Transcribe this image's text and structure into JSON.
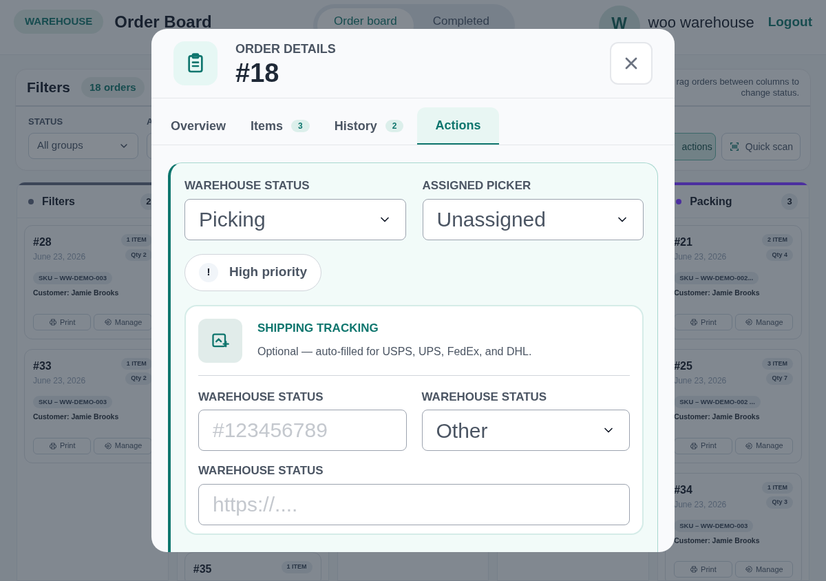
{
  "header": {
    "badge": "WAREHOUSE",
    "title": "Order Board",
    "nav_tabs": [
      {
        "label": "Order board",
        "selected": true
      },
      {
        "label": "Completed",
        "selected": false
      }
    ],
    "avatar": "W",
    "user": "woo warehouse",
    "logout": "Logout"
  },
  "filters": {
    "title": "Filters",
    "count": "18 orders",
    "hint": "rag orders between columns to change status.",
    "fields": [
      {
        "label": "STATUS",
        "value": "All groups"
      },
      {
        "label": "A"
      }
    ],
    "buttons": [
      {
        "kind": "actions",
        "label": "actions",
        "selected": true
      },
      {
        "kind": "scan",
        "label": "Quick scan",
        "selected": false
      }
    ]
  },
  "columns": [
    {
      "title": "Filters",
      "color": "#3b4557",
      "count": "2",
      "cards": [
        {
          "number": "#28",
          "items": "1 ITEM",
          "qty": "Qty 2",
          "date": "June 23, 2026",
          "sku": "SKU – WW-DEMO-003",
          "customer": "Customer: Jamie Brooks",
          "actions": [
            "Print",
            "Manage"
          ]
        },
        {
          "number": "#33",
          "items": "1 ITEM",
          "qty": "Qty 2",
          "date": "June 23, 2026",
          "sku": "SKU – WW-DEMO-003",
          "customer": "Customer: Jamie Brooks",
          "actions": [
            "Print",
            "Manage"
          ]
        }
      ]
    },
    {
      "cards": [
        {
          "number": "#35",
          "items": "1 ITEM"
        }
      ]
    },
    {},
    {},
    {
      "title": "Packing",
      "color": "#4c2f9f",
      "count": "3",
      "cards": [
        {
          "number": "#21",
          "items": "2 ITEM",
          "qty": "Qty 4",
          "date": "June 23, 2026",
          "sku": "SKU – WW-DEMO-002...",
          "customer": "Customer: Jamie Brooks",
          "actions": [
            "Print",
            "Manage"
          ]
        },
        {
          "number": "#25",
          "items": "3 ITEM",
          "qty": "Qty 7",
          "date": "June 23, 2026",
          "sku": "SKU – WW-DEMO-002 ...",
          "customer": "Customer: Jamie Brooks",
          "actions": [
            "Print",
            "Manage"
          ]
        },
        {
          "number": "#34",
          "items": "1 ITEM",
          "qty": "Qty 3",
          "date": "June 23, 2026",
          "sku": "SKU – WW-DEMO-003",
          "customer": "Customer: Jamie Brooks",
          "actions": [
            "Print",
            "Manage"
          ]
        }
      ]
    }
  ],
  "modal": {
    "eyebrow": "ORDER DETAILS",
    "title": "#18",
    "tabs": [
      {
        "label": "Overview",
        "selected": false
      },
      {
        "label": "Items",
        "count": "3",
        "selected": false
      },
      {
        "label": "History",
        "count": "2",
        "selected": false
      },
      {
        "label": "Actions",
        "selected": true
      }
    ],
    "fields": [
      {
        "label": "WAREHOUSE STATUS",
        "value": "Picking"
      },
      {
        "label": "ASSIGNED PICKER",
        "value": "Unassigned"
      }
    ],
    "priority": {
      "icon": "!",
      "label": "High priority",
      "on": false
    },
    "tracking": {
      "title": "SHIPPING TRACKING",
      "description": "Optional — auto-filled for USPS, UPS, FedEx, and DHL.",
      "fields": [
        {
          "kind": "input",
          "label": "WAREHOUSE STATUS",
          "placeholder": "#123456789"
        },
        {
          "kind": "select",
          "label": "WAREHOUSE STATUS",
          "value": "Other"
        },
        {
          "kind": "input",
          "label": "WAREHOUSE STATUS",
          "placeholder": "https://....",
          "wide": true
        }
      ]
    }
  }
}
